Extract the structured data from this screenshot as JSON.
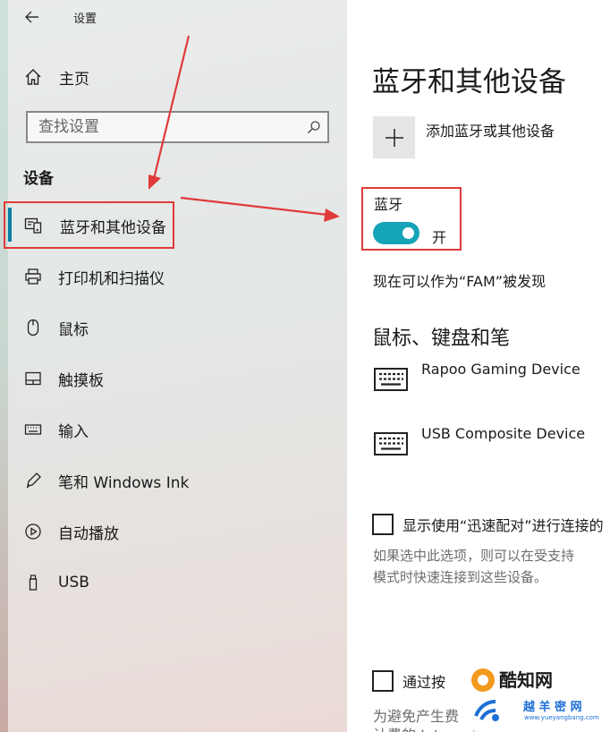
{
  "window": {
    "title": "设置"
  },
  "nav": {
    "home_label": "主页",
    "search_placeholder": "查找设置",
    "section_heading": "设备",
    "items": [
      {
        "label": "蓝牙和其他设备",
        "icon": "bluetooth-devices-icon",
        "selected": true
      },
      {
        "label": "打印机和扫描仪",
        "icon": "printer-icon"
      },
      {
        "label": "鼠标",
        "icon": "mouse-icon"
      },
      {
        "label": "触摸板",
        "icon": "touchpad-icon"
      },
      {
        "label": "输入",
        "icon": "keyboard-icon"
      },
      {
        "label": "笔和 Windows Ink",
        "icon": "pen-icon"
      },
      {
        "label": "自动播放",
        "icon": "autoplay-icon"
      },
      {
        "label": "USB",
        "icon": "usb-icon"
      }
    ]
  },
  "content": {
    "page_title": "蓝牙和其他设备",
    "add_device_label": "添加蓝牙或其他设备",
    "bluetooth": {
      "label": "蓝牙",
      "state_label": "开",
      "enabled": true,
      "discoverable_text": "现在可以作为“FAM”被发现"
    },
    "input_section": {
      "heading": "鼠标、键盘和笔",
      "devices": [
        {
          "name": "Rapoo Gaming Device",
          "icon": "keyboard-icon"
        },
        {
          "name": "USB Composite Device",
          "icon": "keyboard-icon"
        }
      ]
    },
    "swift_pair": {
      "checkbox_label": "显示使用“迅速配对”进行连接的",
      "checked": false,
      "description_line1": "如果选中此选项，则可以在受支持",
      "description_line2": "模式时快速连接到这些设备。"
    },
    "metered": {
      "checkbox_label_visible": "通过按",
      "checked": false,
      "description_visible": "为避免产生费",
      "description_line2_visible": "计费的 Internet"
    }
  },
  "watermark": {
    "brand": "酷知网",
    "site_name": "越 羊 密 网",
    "site_url": "www.yueyangbang.com"
  },
  "colors": {
    "accent": "#0a7ea4",
    "toggle_on": "#15a3b7",
    "annotation_red": "#e03a3a",
    "watermark_blue": "#1d6fd6"
  }
}
